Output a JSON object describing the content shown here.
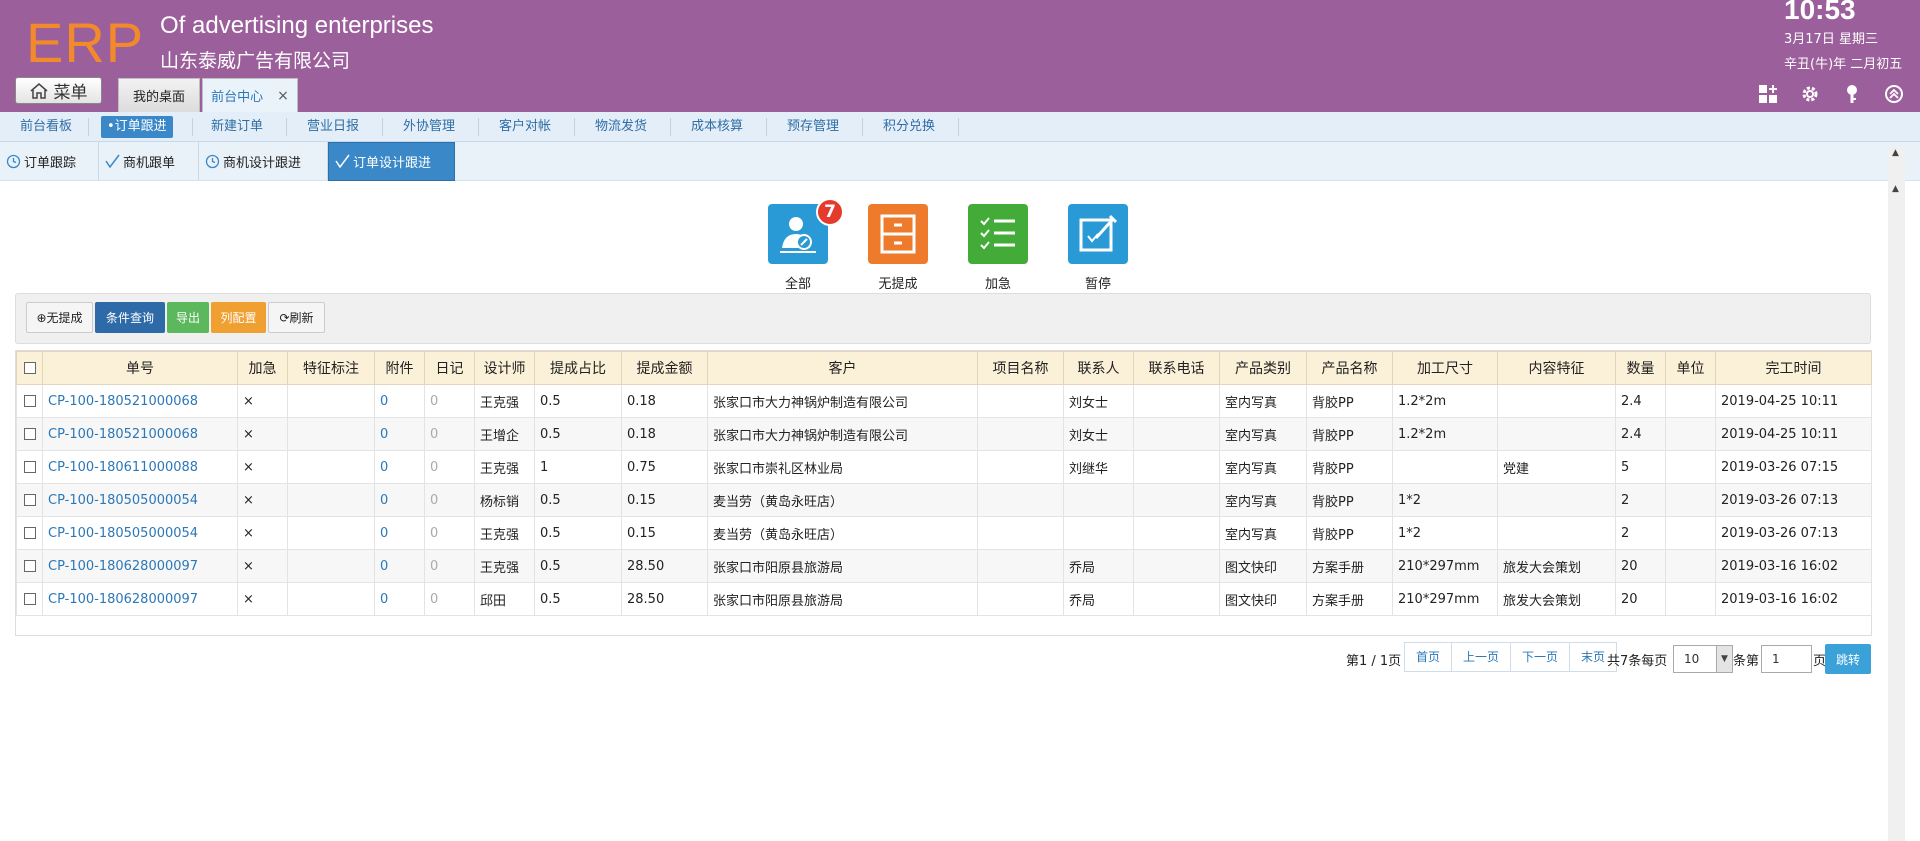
{
  "header": {
    "logo": "ERP",
    "company_en": "Of advertising enterprises",
    "company_cn": "山东泰威广告有限公司",
    "time": "10:53",
    "date": "3月17日 星期三",
    "lunar": "辛丑(牛)年 二月初五",
    "menu_label": "菜单",
    "tabs": [
      {
        "label": "我的桌面"
      },
      {
        "label": "前台中心",
        "close": "×"
      }
    ]
  },
  "mainnav": [
    {
      "label": "前台看板"
    },
    {
      "label": "•订单跟进"
    },
    {
      "label": "新建订单"
    },
    {
      "label": "营业日报"
    },
    {
      "label": "外协管理"
    },
    {
      "label": "客户对帐"
    },
    {
      "label": "物流发货"
    },
    {
      "label": "成本核算"
    },
    {
      "label": "预存管理"
    },
    {
      "label": "积分兑换"
    }
  ],
  "subnav": [
    {
      "label": "订单跟踪",
      "icon": "clock-icon"
    },
    {
      "label": "商机跟单",
      "icon": "check-icon"
    },
    {
      "label": "商机设计跟进",
      "icon": "clock-icon"
    },
    {
      "label": "订单设计跟进",
      "icon": "check-icon"
    }
  ],
  "status_buttons": [
    {
      "label": "全部",
      "badge": "7",
      "color": "#2a9ad6"
    },
    {
      "label": "无提成",
      "color": "#ee7a2c"
    },
    {
      "label": "加急",
      "color": "#43ab37"
    },
    {
      "label": "暂停",
      "color": "#2a9ad6"
    }
  ],
  "toolbar": {
    "no_commission": "⊕无提成",
    "query": "条件查询",
    "export": "导出",
    "columns": "列配置",
    "refresh": "⟳刷新"
  },
  "table": {
    "headers": [
      "单号",
      "加急",
      "特征标注",
      "附件",
      "日记",
      "设计师",
      "提成占比",
      "提成金额",
      "客户",
      "项目名称",
      "联系人",
      "联系电话",
      "产品类别",
      "产品名称",
      "加工尺寸",
      "内容特征",
      "数量",
      "单位",
      "完工时间"
    ],
    "rows": [
      [
        "CP-100-180521000068",
        "×",
        "",
        "0",
        "0",
        "王克强",
        "0.5",
        "0.18",
        "张家口市大力神锅炉制造有限公司",
        "",
        "刘女士",
        "",
        "室内写真",
        "背胶PP",
        "1.2*2m",
        "",
        "2.4",
        "",
        "2019-04-25 10:11"
      ],
      [
        "CP-100-180521000068",
        "×",
        "",
        "0",
        "0",
        "王增企",
        "0.5",
        "0.18",
        "张家口市大力神锅炉制造有限公司",
        "",
        "刘女士",
        "",
        "室内写真",
        "背胶PP",
        "1.2*2m",
        "",
        "2.4",
        "",
        "2019-04-25 10:11"
      ],
      [
        "CP-100-180611000088",
        "×",
        "",
        "0",
        "0",
        "王克强",
        "1",
        "0.75",
        "张家口市崇礼区林业局",
        "",
        "刘继华",
        "",
        "室内写真",
        "背胶PP",
        "",
        "党建",
        "5",
        "",
        "2019-03-26 07:15"
      ],
      [
        "CP-100-180505000054",
        "×",
        "",
        "0",
        "0",
        "杨标销",
        "0.5",
        "0.15",
        "麦当劳（黄岛永旺店）",
        "",
        "",
        "",
        "室内写真",
        "背胶PP",
        "1*2",
        "",
        "2",
        "",
        "2019-03-26 07:13"
      ],
      [
        "CP-100-180505000054",
        "×",
        "",
        "0",
        "0",
        "王克强",
        "0.5",
        "0.15",
        "麦当劳（黄岛永旺店）",
        "",
        "",
        "",
        "室内写真",
        "背胶PP",
        "1*2",
        "",
        "2",
        "",
        "2019-03-26 07:13"
      ],
      [
        "CP-100-180628000097",
        "×",
        "",
        "0",
        "0",
        "王克强",
        "0.5",
        "28.50",
        "张家口市阳原县旅游局",
        "",
        "乔局",
        "",
        "图文快印",
        "方案手册",
        "210*297mm",
        "旅发大会策划",
        "20",
        "",
        "2019-03-16 16:02"
      ],
      [
        "CP-100-180628000097",
        "×",
        "",
        "0",
        "0",
        "邱田",
        "0.5",
        "28.50",
        "张家口市阳原县旅游局",
        "",
        "乔局",
        "",
        "图文快印",
        "方案手册",
        "210*297mm",
        "旅发大会策划",
        "20",
        "",
        "2019-03-16 16:02"
      ]
    ]
  },
  "pager": {
    "page_info": "第1 / 1页",
    "first": "首页",
    "prev": "上一页",
    "next": "下一页",
    "last": "末页",
    "total": "共7条每页",
    "per_page": "10",
    "unit": "条第",
    "page_input": "1",
    "page_suffix": "页",
    "go": "跳转"
  }
}
